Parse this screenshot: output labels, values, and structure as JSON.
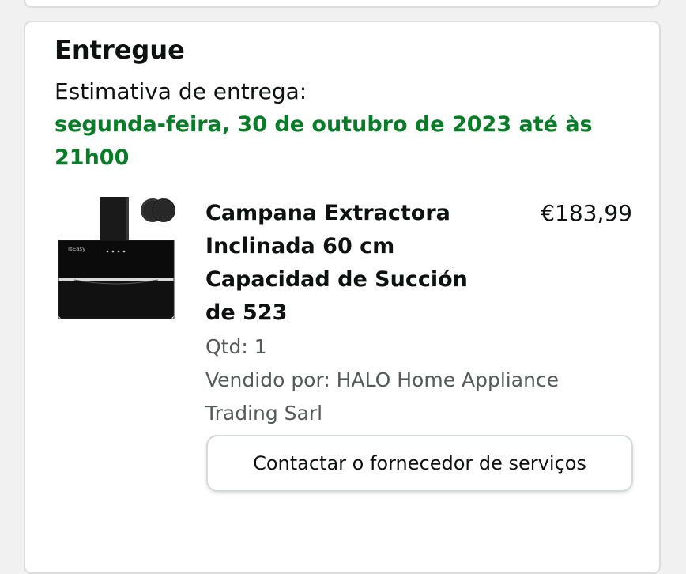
{
  "order": {
    "status_title": "Entregue",
    "estimate_label": "Estimativa de entrega:",
    "estimate_date": "segunda-feira, 30 de outubro de 2023 até às 21h00"
  },
  "item": {
    "title": "Campana Extractora Inclinada 60 cm Capacidad de Succión de 523",
    "price": "€183,99",
    "quantity": "Qtd: 1",
    "seller": "Vendido por: HALO Home Appliance Trading Sarl",
    "image_brand_text": "IsEasy",
    "image_name": "range-hood-product-image"
  },
  "actions": {
    "contact_label": "Contactar o fornecedor de serviços"
  },
  "colors": {
    "delivery_green": "#067d26",
    "secondary_text": "#565959",
    "border": "#dddddd"
  }
}
